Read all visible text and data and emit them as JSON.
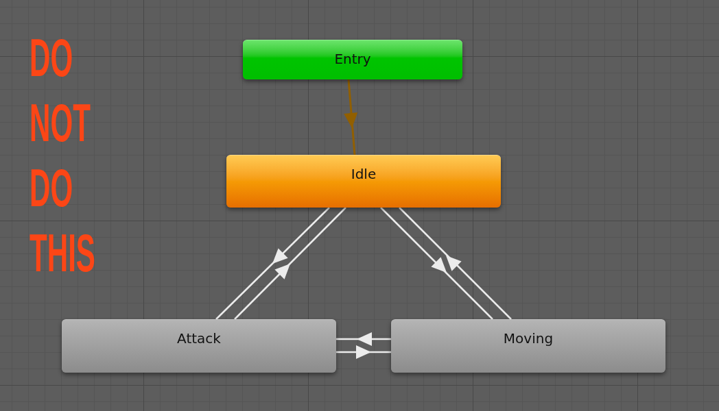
{
  "annotation": {
    "text": "DO NOT DO THIS"
  },
  "nodes": [
    {
      "label": "Entry",
      "kind": "entry"
    },
    {
      "label": "Idle",
      "kind": "default"
    },
    {
      "label": "Attack",
      "kind": "state"
    },
    {
      "label": "Moving",
      "kind": "state"
    }
  ]
}
